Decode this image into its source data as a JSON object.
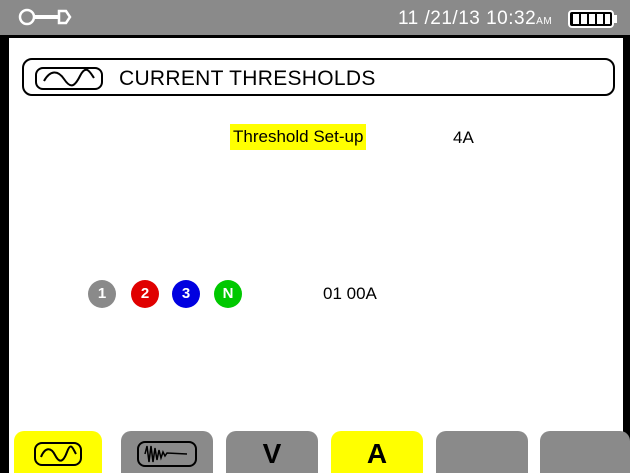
{
  "status_bar": {
    "datetime": "11 /21/13  10:32",
    "ampm": "AM",
    "tool_icon": "wrench-icon",
    "battery_icon": "battery-icon"
  },
  "title": {
    "icon": "waveform-icon",
    "text": "CURRENT THRESHOLDS"
  },
  "threshold": {
    "label": "Threshold Set-up",
    "value": "4A"
  },
  "phases": [
    {
      "label": "1",
      "color": "#8a8a8a"
    },
    {
      "label": "2",
      "color": "#e00000"
    },
    {
      "label": "3",
      "color": "#0000e0"
    },
    {
      "label": "N",
      "color": "#00c800"
    }
  ],
  "current": {
    "value": "01 00A"
  },
  "function_keys": [
    {
      "type": "icon",
      "icon": "waveform-icon",
      "active": true
    },
    {
      "type": "icon",
      "icon": "inrush-icon",
      "active": false
    },
    {
      "type": "text",
      "label": "V",
      "active": false
    },
    {
      "type": "text",
      "label": "A",
      "active": true
    },
    {
      "type": "blank",
      "label": "",
      "active": false
    },
    {
      "type": "blank",
      "label": "",
      "active": false
    }
  ],
  "colors": {
    "accent": "#ffff00",
    "bar_gray": "#8a8a8a"
  }
}
